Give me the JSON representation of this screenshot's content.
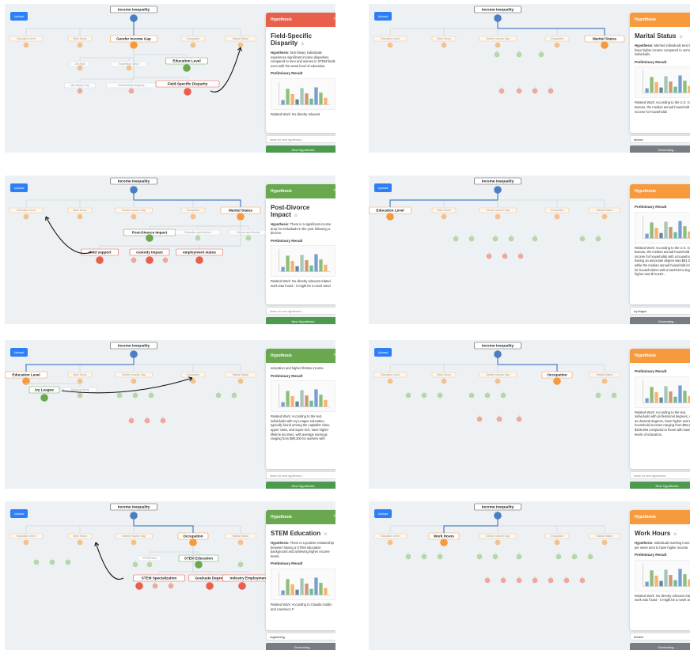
{
  "colors": {
    "red": "#e8604c",
    "orange": "#f79a3e",
    "green": "#6aa84f",
    "blue": "#4a7fc1",
    "button_green": "#4d9a4f",
    "button_gray": "#777d83"
  },
  "common": {
    "upload_label": "Upload",
    "root_label": "Income Inequality",
    "close_glyph": "×",
    "star_glyph": "☆",
    "new_label": "New Hypothesis",
    "generating_label": "Generating...",
    "ideas_placeholder": "Ideas for new hypothesis..."
  },
  "panels": [
    {
      "header": "Hypothesis",
      "theme": "red",
      "title": "Field-Specific Disparity",
      "hyp": "Non-binary individuals experience significant income disparities compared to men and women in STEM fields even with the same level of education.",
      "result_label": "Preliminary Result",
      "related": "Related Work: No directly relevant",
      "input_value": "",
      "button": "new",
      "nodes": [
        "Education Level",
        "Work Hours",
        "Gender Income Gap",
        "Occupation",
        "Marital Status",
        "Job Type",
        "Experience Level",
        "Education Level",
        "Non-Binary Gap",
        "Intersectional Disparity",
        "Field-Specific Disparity"
      ]
    },
    {
      "header": "Hypothesis",
      "theme": "orange",
      "title": "Marital Status",
      "hyp": "Married individuals tend to have higher income compared to unmarried individuals.",
      "result_label": "Preliminary Result",
      "related": "Related Work: According to the U.S. Census Bureau, the median annual household income for households",
      "input_value": "divorce",
      "button": "gen",
      "nodes": [
        "Education Level",
        "Work Hours",
        "Gender Income Gap",
        "Occupation",
        "Marital Status"
      ]
    },
    {
      "header": "Hypothesis",
      "theme": "green",
      "title": "Post-Divorce Impact",
      "hyp": "There is a significant income drop for individuals in the year following a divorce.",
      "result_label": "Preliminary Result",
      "related": "Related Work: No directly relevant related work was found - it might be a novel area!",
      "input_value": "",
      "button": "new",
      "nodes": [
        "Education Level",
        "Work Hours",
        "Gender Income Gap",
        "Occupation",
        "Marital Status",
        "Post-Divorce Impact",
        "Education and Divorce",
        "Divorce and Gender",
        "child support",
        "custody impact",
        "employment status"
      ]
    },
    {
      "header": "Hypothesis",
      "theme": "orange",
      "title": "",
      "hyp": "",
      "result_label": "Preliminary Result",
      "related": "Related Work: According to the U.S. Census Bureau, the median annual household income for households with a householder having an associate degree was $91,070, while the median annual household income for householders with a bachelor's degree or higher was $73,449...",
      "input_value": "ivy league",
      "button": "gen",
      "nodes": [
        "Education Level",
        "Work Hours",
        "Gender Income Gap",
        "Occupation",
        "Marital Status"
      ]
    },
    {
      "header": "Hypothesis",
      "theme": "green",
      "title": "",
      "hyp": "education and higher lifetime income.",
      "result_label": "Preliminary Result",
      "related": "Related Work: According to the text, individuals with Ivy League education, typically found among the capitalist class, upper class, and super-rich, have higher lifetime incomes, with average earnings ranging from $99,300 for workers with",
      "input_value": "",
      "button": "new",
      "nodes": [
        "Education Level",
        "Work Hours",
        "Gender Income Gap",
        "Occupation",
        "Marital Status",
        "Ivy League",
        "Technical Study"
      ]
    },
    {
      "header": "Hypothesis",
      "theme": "orange",
      "title": "",
      "hyp": "",
      "result_label": "Preliminary Result",
      "related": "Related Work: According to the text, individuals with professional degrees, such as doctoral degrees, have higher average household incomes ranging from $92,614 to $109,966 compared to those with lower levels of education.",
      "input_value": "",
      "button": "new",
      "nodes": [
        "Education Level",
        "Work Hours",
        "Gender Income Gap",
        "Occupation",
        "Marital Status"
      ]
    },
    {
      "header": "Hypothesis",
      "theme": "green",
      "title": "STEM Education",
      "hyp": "There is a positive relationship between having a STEM education background and achieving higher income levels.",
      "result_label": "Preliminary Result",
      "related": "Related Work: According to Claudia Goldin and Lawrence F.",
      "input_value": "engineering",
      "button": "gen",
      "nodes": [
        "Education Level",
        "Work Hours",
        "Gender Income Gap",
        "Occupation",
        "Marital Status",
        "STEM Field",
        "Industry",
        "STEM Education",
        "STEM Specialization",
        "Graduate Degree",
        "Industry Employment"
      ]
    },
    {
      "header": "Hypothesis",
      "theme": "orange",
      "title": "Work Hours",
      "hyp": "Individuals working more hours per week tend to have higher income.",
      "result_label": "Preliminary Result",
      "related": "Related Work: No directly relevant related work was found - it might be a novel area!",
      "input_value": "full time",
      "button": "gen",
      "nodes": [
        "Education Level",
        "Work Hours",
        "Gender Income Gap",
        "Occupation",
        "Marital Status"
      ]
    }
  ]
}
